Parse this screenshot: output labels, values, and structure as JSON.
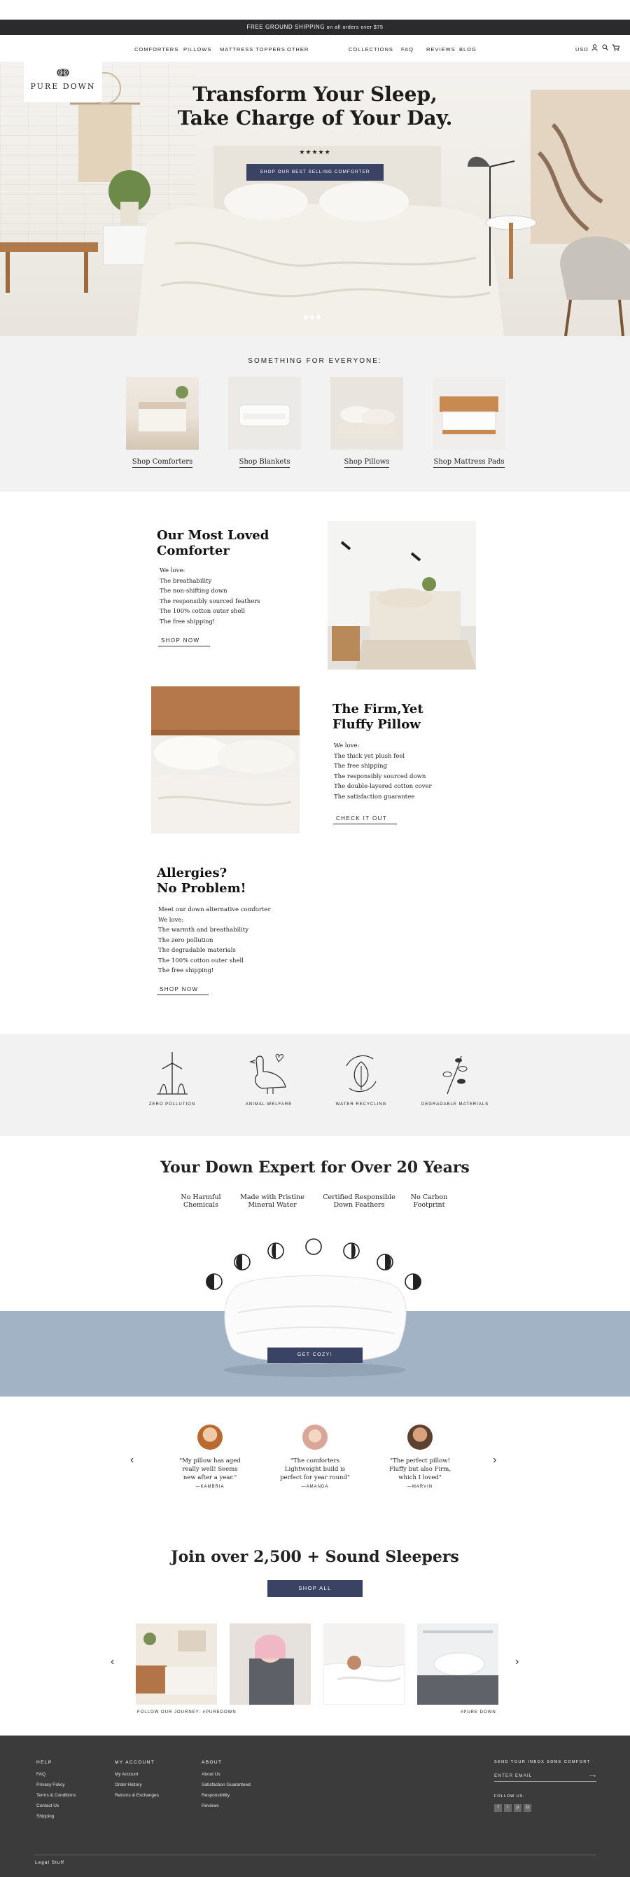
{
  "announcement": {
    "bold": "FREE GROUND SHIPPING",
    "rest": " on all orders over $75"
  },
  "nav": {
    "left": [
      "COMFORTERS",
      "PILLOWS",
      "MATTRESS TOPPERS",
      "OTHER"
    ],
    "right": [
      "COLLECTIONS",
      "FAQ",
      "REVIEWS",
      "BLOG"
    ],
    "currency": "USD",
    "icons": [
      "user-icon",
      "search-icon",
      "cart-icon"
    ]
  },
  "logo": {
    "text": "PURE DOWN"
  },
  "hero": {
    "title_line1": "Transform Your Sleep,",
    "title_line2": "Take Charge of Your Day.",
    "stars": "★★★★★",
    "cta": "SHOP OUR BEST SELLING COMFORTER",
    "slides": 3,
    "active_slide": 3
  },
  "categories": {
    "heading": "SOMETHING FOR EVERYONE:",
    "items": [
      "Shop Comforters",
      "Shop Blankets",
      "Shop Pillows",
      "Shop Mattress Pads"
    ]
  },
  "features": [
    {
      "title1": "Our Most Loved",
      "title2": "Comforter",
      "lines": [
        "We love:",
        "The breathability",
        "The non-shifting down",
        "The responsibly sourced feathers",
        "The 100% cotton outer shell",
        "The free shipping!"
      ],
      "link": "SHOP NOW"
    },
    {
      "title1": "The Firm,Yet",
      "title2": "Fluffy Pillow",
      "lines": [
        "We love:",
        "The thick yet plush feel",
        "The free shipping",
        "The responsibly sourced down",
        "The double-layered cotton cover",
        "The satisfaction guarantee"
      ],
      "link": "CHECK IT OUT"
    },
    {
      "title1": "Allergies?",
      "title2": "No Problem!",
      "lines": [
        "Meet our down alternative comforter",
        "We love:",
        "The warmth and breathability",
        "The zero pollution",
        "The degradable materials",
        "The 100% cotton outer shell",
        "The free shipping!"
      ],
      "link": "SHOP NOW"
    }
  ],
  "values": [
    "ZERO POLLUTION",
    "ANIMAL WELFARE",
    "WATER RECYCLING",
    "DEGRADABLE MATERIALS"
  ],
  "expert": {
    "title": "Your Down Expert for Over 20 Years",
    "points": [
      {
        "l1": "No Harmful",
        "l2": "Chemicals"
      },
      {
        "l1": "Made with Pristine",
        "l2": "Mineral Water"
      },
      {
        "l1": "Certified Responsible",
        "l2": "Down Feathers"
      },
      {
        "l1": "No Carbon",
        "l2": "Footprint"
      }
    ],
    "cta": "GET COZY!"
  },
  "reviews": [
    {
      "l1": "\"My pillow has aged",
      "l2": "really well! Seems",
      "l3": "new after a year.\"",
      "author": "—KAMBRIA"
    },
    {
      "l1": "\"The comforters",
      "l2": "Lightweight build is",
      "l3": "perfect for year round\"",
      "author": "—AMANDA"
    },
    {
      "l1": "\"The perfect pillow!",
      "l2": "Fluffy but also Firm,",
      "l3": "which I loved\"",
      "author": "—MARVIN"
    }
  ],
  "join": {
    "title": "Join over 2,500 + Sound Sleepers",
    "cta": "SHOP ALL",
    "caption_left": "FOLLOW OUR JOURNEY: #PUREDOWN",
    "caption_right": "#PURE DOWN"
  },
  "footer": {
    "help": {
      "heading": "HELP",
      "links": [
        "FAQ",
        "Privacy Policy",
        "Terms & Conditions",
        "Contact Us",
        "Shipping"
      ]
    },
    "account": {
      "heading": "MY ACCOUNT",
      "links": [
        "My Account",
        "Order History",
        "Returns & Exchanges"
      ]
    },
    "about": {
      "heading": "ABOUT",
      "links": [
        "About Us",
        "Satisfaction Guaranteed",
        "Responsibility",
        "Reviews"
      ]
    },
    "newsletter": {
      "heading": "SEND YOUR INBOX SOME COMFORT",
      "placeholder": "ENTER EMAIL"
    },
    "follow": "FOLLOW US:",
    "legal": "Legal Stuff"
  },
  "colors": {
    "navy": "#3a4364",
    "footer": "#3b3b3b",
    "band_blue": "#a3b3c6",
    "light_gray": "#f2f2f2"
  }
}
